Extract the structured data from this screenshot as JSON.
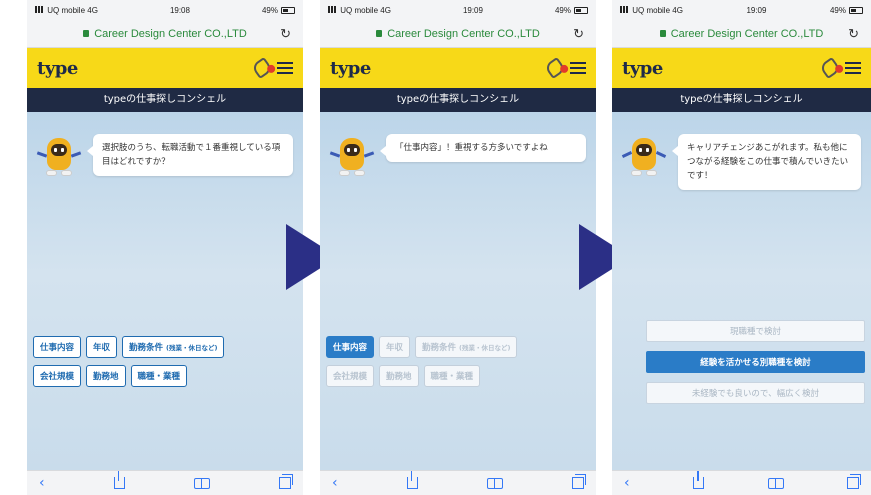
{
  "phones": [
    {
      "status": {
        "carrier": "UQ mobile",
        "network": "4G",
        "time": "19:08",
        "battery": "49%"
      },
      "url": "Career Design Center CO.,LTD",
      "logo": "type",
      "title": "typeの仕事探しコンシェル",
      "bubble": "選択肢のうち、転職活動で１番重視している項目はどれですか？",
      "chips_row1": [
        {
          "label": "仕事内容",
          "sub": ""
        },
        {
          "label": "年収",
          "sub": ""
        },
        {
          "label": "勤務条件",
          "sub": "(残業・休日など)"
        }
      ],
      "chips_row2": [
        {
          "label": "会社規模",
          "sub": ""
        },
        {
          "label": "勤務地",
          "sub": ""
        },
        {
          "label": "職種・業種",
          "sub": ""
        }
      ]
    },
    {
      "status": {
        "carrier": "UQ mobile",
        "network": "4G",
        "time": "19:09",
        "battery": "49%"
      },
      "url": "Career Design Center CO.,LTD",
      "logo": "type",
      "title": "typeの仕事探しコンシェル",
      "bubble": "「仕事内容」！重視する方多いですよね",
      "selected_chip": "仕事内容",
      "chips_row1": [
        {
          "label": "仕事内容",
          "sub": ""
        },
        {
          "label": "年収",
          "sub": ""
        },
        {
          "label": "勤務条件",
          "sub": "(残業・休日など)"
        }
      ],
      "chips_row2": [
        {
          "label": "会社規模",
          "sub": ""
        },
        {
          "label": "勤務地",
          "sub": ""
        },
        {
          "label": "職種・業種",
          "sub": ""
        }
      ]
    },
    {
      "status": {
        "carrier": "UQ mobile",
        "network": "4G",
        "time": "19:09",
        "battery": "49%"
      },
      "url": "Career Design Center CO.,LTD",
      "logo": "type",
      "title": "typeの仕事探しコンシェル",
      "bubble": "キャリアチェンジあこがれます。私も他につながる経験をこの仕事で積んでいきたいです！",
      "options": [
        {
          "label": "現職種で検討",
          "selected": false
        },
        {
          "label": "経験を活かせる別職種を検討",
          "selected": true
        },
        {
          "label": "未経験でも良いので、幅広く検討",
          "selected": false
        }
      ]
    }
  ],
  "icons": {
    "arrow": "play-arrow-icon",
    "lock": "lock-icon",
    "reload": "reload-icon",
    "clip": "clip-icon",
    "menu": "menu-icon",
    "back": "back-icon",
    "share": "share-icon",
    "bookmarks": "book-icon",
    "tabs": "tabs-icon"
  },
  "colors": {
    "header_yellow": "#f7d918",
    "titlebar_navy": "#1f2a44",
    "accent_blue": "#2a7cc7",
    "arrow_navy": "#2b2f86"
  },
  "toolbar": {
    "back": "‹"
  }
}
